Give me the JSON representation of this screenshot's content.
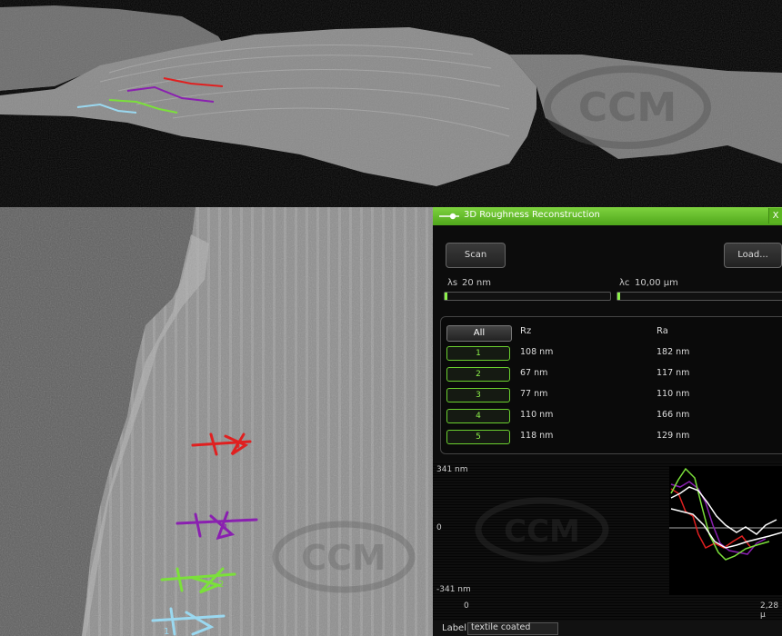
{
  "panel": {
    "title": "3D Roughness Reconstruction",
    "close_label": "X",
    "scan_label": "Scan",
    "load_label": "Load...",
    "lambda_s": {
      "symbol": "λs",
      "value": "20 nm"
    },
    "lambda_c": {
      "symbol": "λc",
      "value": "10,00 µm"
    },
    "table": {
      "all_label": "All",
      "columns": [
        "Rz",
        "Ra"
      ],
      "rows": [
        {
          "id": "1",
          "rz": "108 nm",
          "ra": "182 nm"
        },
        {
          "id": "2",
          "rz": "67 nm",
          "ra": "117 nm"
        },
        {
          "id": "3",
          "rz": "77 nm",
          "ra": "110 nm"
        },
        {
          "id": "4",
          "rz": "110 nm",
          "ra": "166 nm"
        },
        {
          "id": "5",
          "rz": "118 nm",
          "ra": "129 nm"
        }
      ]
    },
    "plot": {
      "y_top": "341 nm",
      "y_mid": "0",
      "y_bottom": "-341 nm",
      "x_start": "0",
      "x_end": "2,28 µ"
    },
    "label_field": {
      "caption": "Label",
      "value": "textile coated"
    }
  },
  "watermark": {
    "text": "CCM",
    "registered": "®"
  },
  "markers": [
    "1",
    "2",
    "3",
    "4"
  ],
  "colors": {
    "accent_green": "#8cf04a",
    "profile_1": "#e02020",
    "profile_2": "#8a20b0",
    "profile_3": "#7be03a",
    "profile_4": "#9ad8f0",
    "profile_5": "#ffffff"
  }
}
